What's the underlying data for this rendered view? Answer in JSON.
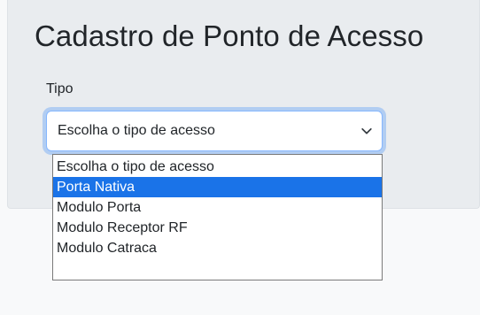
{
  "form": {
    "title": "Cadastro de Ponto de Acesso",
    "type_label": "Tipo",
    "type_select": {
      "value": "Escolha o tipo de acesso",
      "icon": "chevron-down-icon",
      "options": [
        "Escolha o tipo de acesso",
        "Porta Nativa",
        "Modulo Porta",
        "Modulo Receptor RF",
        "Modulo Catraca"
      ],
      "highlighted": "Porta Nativa"
    }
  },
  "colors": {
    "page_background": "#f8f9fa",
    "card_background": "#e9ecef",
    "focus_border": "#86b7fe",
    "highlight": "#1a73e8"
  }
}
